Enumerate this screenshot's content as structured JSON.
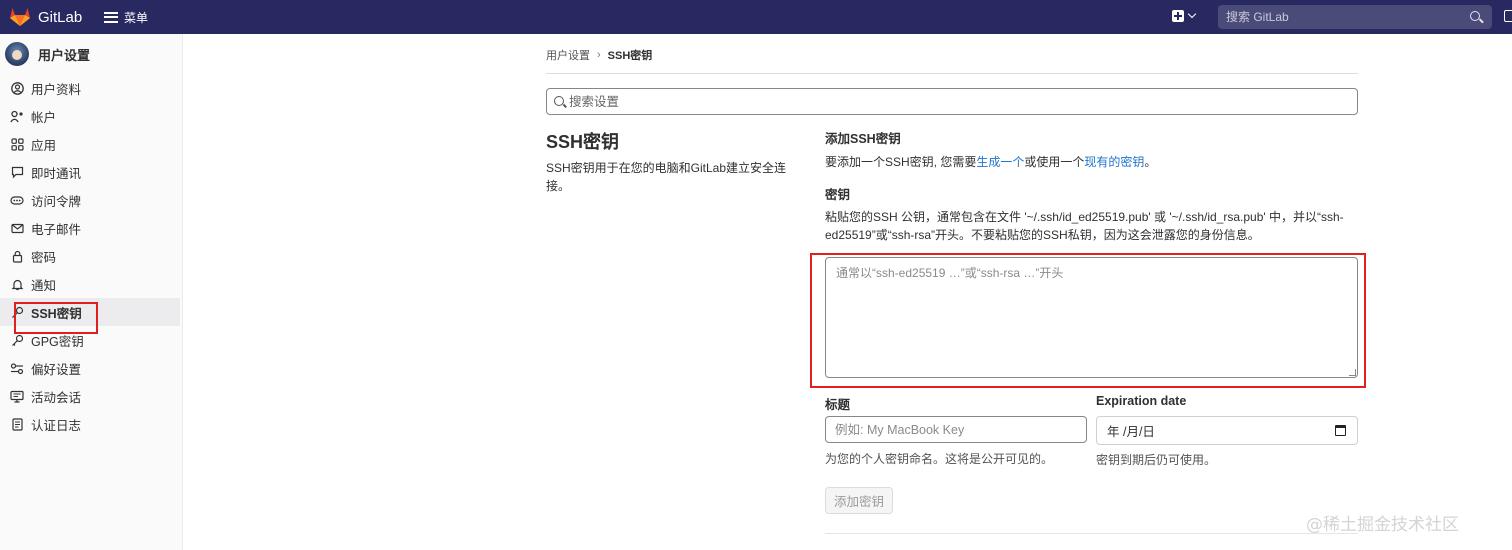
{
  "topbar": {
    "brand": "GitLab",
    "menu_label": "菜单",
    "search_placeholder": "搜索 GitLab",
    "colors": {
      "background": "#292961",
      "logo": "#e24329"
    }
  },
  "sidebar": {
    "title": "用户设置",
    "items": [
      {
        "label": "用户资料",
        "icon": "user-icon"
      },
      {
        "label": "帐户",
        "icon": "account-icon"
      },
      {
        "label": "应用",
        "icon": "applications-icon"
      },
      {
        "label": "即时通讯",
        "icon": "chat-icon"
      },
      {
        "label": "访问令牌",
        "icon": "token-icon"
      },
      {
        "label": "电子邮件",
        "icon": "mail-icon"
      },
      {
        "label": "密码",
        "icon": "lock-icon"
      },
      {
        "label": "通知",
        "icon": "bell-icon"
      },
      {
        "label": "SSH密钥",
        "icon": "key-icon",
        "active": true
      },
      {
        "label": "GPG密钥",
        "icon": "key-icon"
      },
      {
        "label": "偏好设置",
        "icon": "preferences-icon"
      },
      {
        "label": "活动会话",
        "icon": "monitor-icon"
      },
      {
        "label": "认证日志",
        "icon": "log-icon"
      }
    ]
  },
  "breadcrumb": {
    "parent": "用户设置",
    "separator": "›",
    "current": "SSH密钥"
  },
  "settings_search": {
    "placeholder": "搜索设置"
  },
  "section": {
    "title": "SSH密钥",
    "description": "SSH密钥用于在您的电脑和GitLab建立安全连接。"
  },
  "form": {
    "add_title": "添加SSH密钥",
    "add_desc_prefix": "要添加一个SSH密钥, 您需要",
    "add_desc_link1": "生成一个",
    "add_desc_middle": "或使用一个",
    "add_desc_link2": "现有的密钥",
    "add_desc_suffix": "。",
    "key_label": "密钥",
    "key_help": "粘贴您的SSH 公钥，通常包含在文件 '~/.ssh/id_ed25519.pub' 或 '~/.ssh/id_rsa.pub' 中，并以“ssh-ed25519”或“ssh-rsa”开头。不要粘贴您的SSH私钥，因为这会泄露您的身份信息。",
    "key_placeholder": "通常以“ssh-ed25519 …”或“ssh-rsa …”开头",
    "title_label": "标题",
    "title_placeholder": "例如: My MacBook Key",
    "title_help": "为您的个人密钥命名。这将是公开可见的。",
    "expiration_label": "Expiration date",
    "expiration_value": "年 /月/日",
    "expiration_help": "密钥到期后仍可使用。",
    "submit_label": "添加密钥"
  },
  "watermark": "@稀土掘金技术社区"
}
